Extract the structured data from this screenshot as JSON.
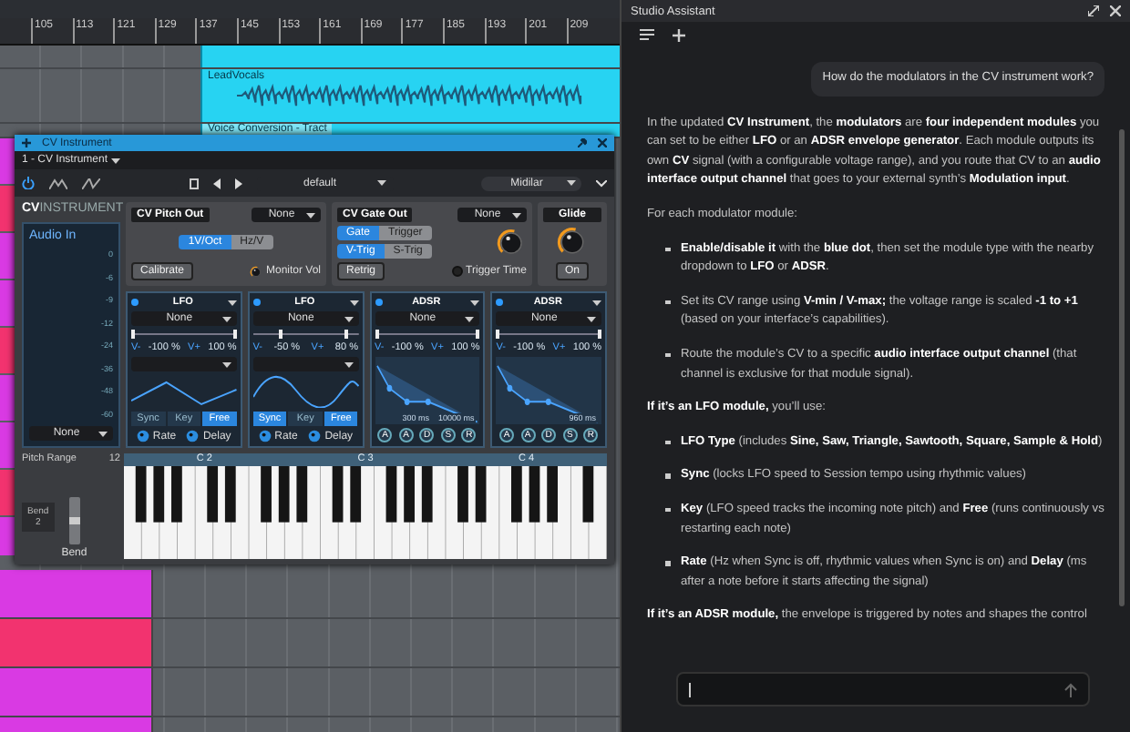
{
  "daw": {
    "ruler_marks": [
      "105",
      "113",
      "121",
      "129",
      "137",
      "145",
      "153",
      "161",
      "169",
      "177",
      "185",
      "193",
      "201",
      "209"
    ],
    "clip_labels": [
      "LeadVocals",
      "Voice Conversion - Tract"
    ]
  },
  "plugin": {
    "title": "CV Instrument",
    "instance": "1 - CV Instrument",
    "preset": "default",
    "midi": "Midilar",
    "logo": {
      "bold": "CV",
      "light": "INSTRUMENT"
    },
    "audio_in": {
      "label": "Audio In",
      "scale": [
        "0",
        "-6",
        "-9",
        "-12",
        "-24",
        "-36",
        "-48",
        "-60"
      ],
      "source": "None"
    },
    "pitch_out": {
      "title": "CV Pitch Out",
      "output": "None",
      "modes": [
        {
          "label": "1V/Oct",
          "selected": true
        },
        {
          "label": "Hz/V",
          "selected": false
        }
      ],
      "calibrate": "Calibrate",
      "monitor": "Monitor Vol"
    },
    "gate_out": {
      "title": "CV Gate Out",
      "output": "None",
      "gate_modes": [
        {
          "label": "Gate",
          "selected": true
        },
        {
          "label": "Trigger",
          "selected": false
        }
      ],
      "trig_modes": [
        {
          "label": "V-Trig",
          "selected": true
        },
        {
          "label": "S-Trig",
          "selected": false
        }
      ],
      "retrig": "Retrig",
      "trigger_time": "Trigger Time"
    },
    "glide": {
      "title": "Glide",
      "button": "On"
    },
    "modules": [
      {
        "kind": "lfo",
        "enabled": true,
        "type": "LFO",
        "output": "None",
        "vmin_label": "V-",
        "vmin": "-100 %",
        "vmax_label": "V+",
        "vmax": "100 %",
        "sine": false,
        "handles": [
          {
            "level": 0
          },
          {
            "level": 1
          }
        ],
        "modes": [
          {
            "label": "Sync",
            "selected": false
          },
          {
            "label": "Key",
            "selected": false
          },
          {
            "label": "Free",
            "selected": true
          }
        ],
        "knobs": [
          "Rate",
          "Delay"
        ]
      },
      {
        "kind": "lfo",
        "enabled": true,
        "type": "LFO",
        "output": "None",
        "vmin_label": "V-",
        "vmin": "-50 %",
        "vmax_label": "V+",
        "vmax": "80 %",
        "sine": true,
        "handles": [
          {
            "level": 0.25
          },
          {
            "level": 0.9
          }
        ],
        "modes": [
          {
            "label": "Sync",
            "selected": true
          },
          {
            "label": "Key",
            "selected": false
          },
          {
            "label": "Free",
            "selected": true
          }
        ],
        "knobs": [
          "Rate",
          "Delay"
        ]
      },
      {
        "kind": "adsr",
        "enabled": true,
        "type": "ADSR",
        "output": "None",
        "vmin_label": "V-",
        "vmin": "-100 %",
        "vmax_label": "V+",
        "vmax": "100 %",
        "handles": [
          {
            "level": 0
          },
          {
            "level": 1
          }
        ],
        "times": [
          "300 ms",
          "10000 ms"
        ],
        "stages": [
          "A",
          "A",
          "D",
          "S",
          "R"
        ]
      },
      {
        "kind": "adsr",
        "enabled": true,
        "type": "ADSR",
        "output": "None",
        "vmin_label": "V-",
        "vmin": "-100 %",
        "vmax_label": "V+",
        "vmax": "100 %",
        "handles": [
          {
            "level": 0
          },
          {
            "level": 1
          }
        ],
        "times": [
          "960 ms"
        ],
        "stages": [
          "A",
          "A",
          "D",
          "S",
          "R"
        ]
      }
    ],
    "keyboard": {
      "pitch_range_label": "Pitch Range",
      "pitch_range": "12",
      "octaves": [
        "C 2",
        "C 3",
        "C 4"
      ],
      "bend_box_label": "Bend",
      "bend_box_value": "2",
      "bend_label": "Bend"
    }
  },
  "assistant": {
    "title": "Studio Assistant",
    "question": "How do the modulators in the CV instrument work?",
    "blocks": [
      {
        "kind": "paragraph",
        "text": "In the updated **CV Instrument**, the **modulators** are **four independent modules** you can set to be either **LFO** or an **ADSR envelope generator**. Each module outputs its own **CV** signal (with a configurable voltage range), and you route that CV to an **audio interface output channel** that goes to your external synth’s **Modulation input**."
      },
      {
        "kind": "paragraph",
        "text": "For each modulator module:"
      },
      {
        "kind": "bullet",
        "text": "**Enable/disable it** with the **blue dot**, then set the module type with the nearby dropdown to **LFO** or **ADSR**."
      },
      {
        "kind": "bullet",
        "text": "Set its CV range using **V-min / V-max;** the voltage range is scaled **-1 to +1** (based on your interface’s capabilities)."
      },
      {
        "kind": "bullet",
        "text": "Route the module’s CV to a specific **audio interface output channel** (that channel is exclusive for that module signal)."
      },
      {
        "kind": "paragraph",
        "text": "**If it’s an LFO module,** you’ll use:"
      },
      {
        "kind": "bullet",
        "text": "**LFO Type** (includes **Sine, Saw, Triangle, Sawtooth, Square, Sample & Hold**)"
      },
      {
        "kind": "bullet",
        "text": "**Sync** (locks LFO speed to Session tempo using rhythmic values)"
      },
      {
        "kind": "bullet",
        "text": "**Key** (LFO speed tracks the incoming note pitch) and **Free** (runs continuously vs restarting each note)"
      },
      {
        "kind": "bullet",
        "text": "**Rate** (Hz when Sync is off, rhythmic values when Sync is on) and **Delay** (ms after a note before it starts affecting the signal)"
      },
      {
        "kind": "paragraph",
        "text": "**If it’s an ADSR module,** the envelope is triggered by notes and shapes the control"
      }
    ]
  }
}
